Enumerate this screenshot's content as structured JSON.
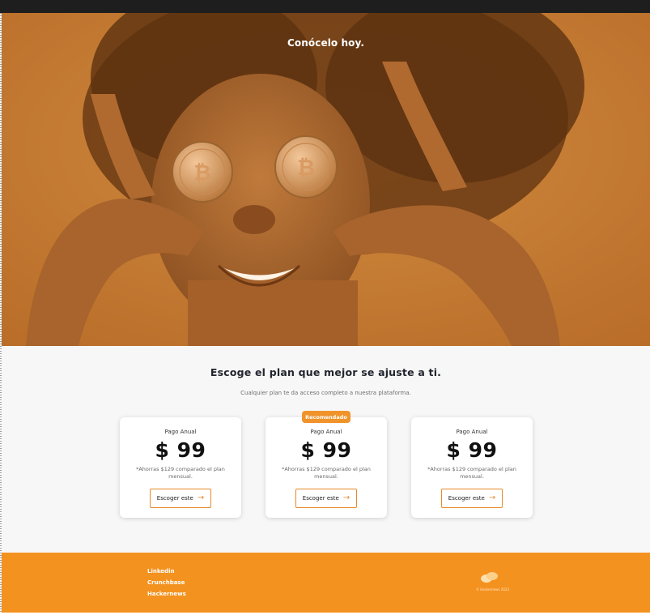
{
  "hero": {
    "title": "Conócelo hoy.",
    "image": "woman holding bitcoin coins over eyes"
  },
  "plans": {
    "title": "Escoge el plan que mejor se ajuste a ti.",
    "subtitle": "Cualquier plan te da acceso completo a nuestra plataforma.",
    "cards": [
      {
        "period": "Pago Anual",
        "price": "$ 99",
        "note": "*Ahorras $129 comparado el plan mensual.",
        "button": "Escoger este"
      },
      {
        "badge": "Recomendado",
        "period": "Pago Anual",
        "price": "$ 99",
        "note": "*Ahorras $129 comparado el plan mensual.",
        "button": "Escoger este"
      },
      {
        "period": "Pago Anual",
        "price": "$ 99",
        "note": "*Ahorras $129 comparado el plan mensual.",
        "button": "Escoger este"
      }
    ]
  },
  "footer": {
    "links": [
      "Linkedin",
      "Crunchbase",
      "Hackernews"
    ],
    "logo_icon": "brand-blob-icon",
    "copyright": "© Hackernews 2023"
  },
  "colors": {
    "accent": "#f4921f",
    "hero_tint": "#c27a33",
    "topbar": "#1e1e1e"
  }
}
